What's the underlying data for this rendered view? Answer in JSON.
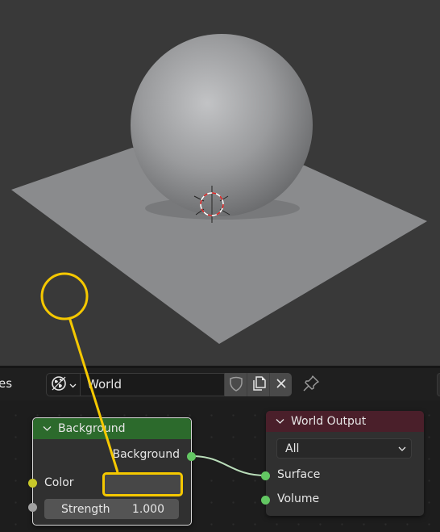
{
  "viewport": {
    "objects": [
      "sphere",
      "plane"
    ],
    "cursor": "3d-cursor"
  },
  "header": {
    "truncated_label": "es",
    "world_icon": "world-icon",
    "datablock_name": "World",
    "fake_user_icon": "shield-icon",
    "duplicate_icon": "duplicate-icon",
    "unlink_icon": "close-icon",
    "pin_icon": "pin-icon"
  },
  "nodes": {
    "background": {
      "title": "Background",
      "header_color": "#2c6a2c",
      "output_label": "Background",
      "color_label": "Color",
      "strength_label": "Strength",
      "strength_value": "1.000",
      "color_socket_color": "#c7c729",
      "strength_socket_color": "#a1a1a1",
      "output_socket_color": "#63c763"
    },
    "world_output": {
      "title": "World Output",
      "header_color": "#4a1f2a",
      "target_selected": "All",
      "surface_label": "Surface",
      "volume_label": "Volume",
      "socket_color": "#63c763"
    }
  },
  "annotation": {
    "highlight_color": "#f5c800"
  }
}
